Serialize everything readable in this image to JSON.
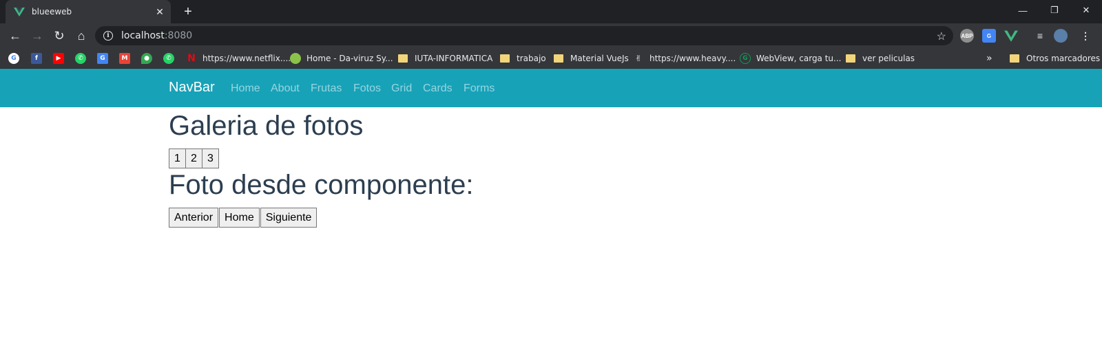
{
  "browser": {
    "tab_title": "blueeweb",
    "url_host": "localhost",
    "url_port": ":8080",
    "bookmarks": [
      {
        "label": "https://www.netflix....",
        "icon": "netflix-icon"
      },
      {
        "label": "Home - Da-viruz Sy...",
        "icon": "daviruz-icon"
      },
      {
        "label": "IUTA-INFORMATICA",
        "icon": "folder-icon"
      },
      {
        "label": "trabajo",
        "icon": "folder-icon"
      },
      {
        "label": "Material VueJs",
        "icon": "folder-icon"
      },
      {
        "label": "https://www.heavy....",
        "icon": "heavy-icon"
      },
      {
        "label": "WebView, carga tu...",
        "icon": "webview-icon"
      },
      {
        "label": "ver peliculas",
        "icon": "folder-icon"
      }
    ],
    "overflow": "»",
    "other_bookmarks": "Otros marcadores"
  },
  "navbar": {
    "brand": "NavBar",
    "links": [
      "Home",
      "About",
      "Frutas",
      "Fotos",
      "Grid",
      "Cards",
      "Forms"
    ]
  },
  "page": {
    "title": "Galeria de fotos",
    "pages": [
      "1",
      "2",
      "3"
    ],
    "subtitle": "Foto desde componente:",
    "buttons": {
      "previous": "Anterior",
      "home": "Home",
      "next": "Siguiente"
    }
  },
  "colors": {
    "navbar_bg": "#17a2b8",
    "heading": "#2c3e50"
  }
}
